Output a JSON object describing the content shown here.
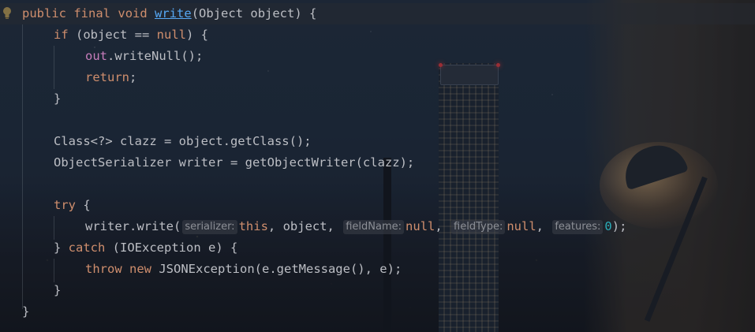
{
  "colors": {
    "keyword": "#cf8e6d",
    "default_text": "#bcbec4",
    "method_declaration": "#56a8f5",
    "static_field": "#c77dbb",
    "number": "#2aacb8",
    "inlay_hint": "#8c8f96"
  },
  "gutter": {
    "icon": "lightbulb-icon"
  },
  "code": {
    "l1": {
      "kw1": "public",
      "kw2": "final",
      "kw3": "void",
      "name": "write",
      "rest": "(Object object) {"
    },
    "l2": {
      "kw": "if",
      "a": " (object == ",
      "null": "null",
      "b": ") {"
    },
    "l3": {
      "field": "out",
      "rest": ".writeNull();"
    },
    "l4": {
      "kw": "return",
      "rest": ";"
    },
    "l5": {
      "text": "}"
    },
    "l7": {
      "text": "Class<?> clazz = object.getClass();"
    },
    "l8": {
      "text": "ObjectSerializer writer = getObjectWriter(clazz);"
    },
    "l10": {
      "kw": "try",
      "rest": " {"
    },
    "l11": {
      "call": "writer.write(",
      "hint1": "serializer:",
      "arg1": "this",
      "sep1": ", object, ",
      "hint2": "fieldName:",
      "arg2": "null",
      "sep2": ", ",
      "hint3": "fieldType:",
      "arg3": "null",
      "sep3": ", ",
      "hint4": "features:",
      "arg4": "0",
      "end": ");"
    },
    "l12": {
      "a": "} ",
      "kw": "catch",
      "b": " (IOException e) {"
    },
    "l13": {
      "kw1": "throw",
      "kw2": "new",
      "rest": " JSONException(e.getMessage(), e);"
    },
    "l14": {
      "text": "}"
    },
    "l15": {
      "text": "}"
    }
  }
}
